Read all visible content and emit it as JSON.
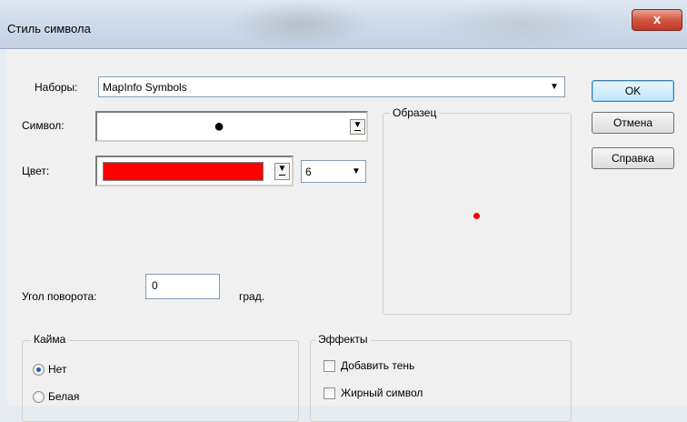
{
  "window": {
    "title": "Стиль символа",
    "close_glyph": "x"
  },
  "form": {
    "sets_label": "Наборы:",
    "sets_value": "MapInfo Symbols",
    "symbol_label": "Символ:",
    "symbol_glyph": "●",
    "color_label": "Цвет:",
    "color_value": "#ff0000",
    "size_value": "6",
    "rotation_label": "Угол поворота:",
    "rotation_value": "0",
    "rotation_unit": "град."
  },
  "preview": {
    "title": "Образец",
    "dot_color": "#ff0000"
  },
  "buttons": {
    "ok": "OK",
    "cancel": "Отмена",
    "help": "Справка"
  },
  "border_group": {
    "title": "Кайма",
    "options": [
      {
        "label": "Нет",
        "selected": true
      },
      {
        "label": "Белая",
        "selected": false
      }
    ]
  },
  "effects_group": {
    "title": "Эффекты",
    "options": [
      {
        "label": "Добавить тень",
        "checked": false
      },
      {
        "label": "Жирный символ",
        "checked": false
      }
    ]
  }
}
